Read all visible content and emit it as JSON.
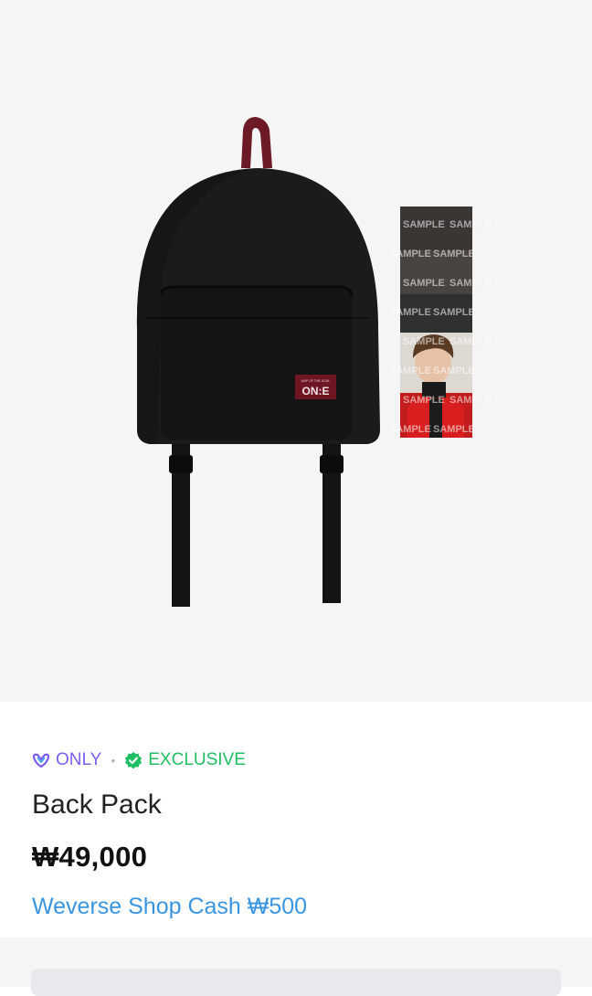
{
  "badges": {
    "only_label": "ONLY",
    "separator": "•",
    "exclusive_label": "EXCLUSIVE"
  },
  "product": {
    "name": "Back Pack",
    "price": "₩49,000",
    "cash": "Weverse Shop Cash ₩500",
    "patch_text_small": "MAP OF THE SOUL",
    "patch_text_large": "ON:E",
    "photocard_watermark": "SAMPLE"
  },
  "colors": {
    "only": "#7d5cf0",
    "exclusive": "#1fbf63",
    "cash": "#3a95e0",
    "strap": "#6b1a26"
  },
  "icons": {
    "only": "weverse-only-icon",
    "exclusive": "verified-badge-icon"
  }
}
